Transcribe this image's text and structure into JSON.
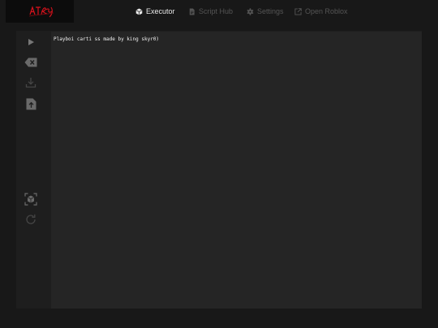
{
  "app": {
    "logo_text": "ATRRY"
  },
  "nav": {
    "items": [
      {
        "label": "Executor",
        "icon": "cube-icon",
        "active": true
      },
      {
        "label": "Script Hub",
        "icon": "document-icon",
        "active": false
      },
      {
        "label": "Settings",
        "icon": "gear-icon",
        "active": false
      },
      {
        "label": "Open Roblox",
        "icon": "external-link-icon",
        "active": false
      }
    ]
  },
  "sidebar": {
    "buttons": [
      {
        "name": "execute-button",
        "icon": "play-icon"
      },
      {
        "name": "clear-button",
        "icon": "backspace-icon"
      },
      {
        "name": "open-file-button",
        "icon": "download-icon"
      },
      {
        "name": "save-file-button",
        "icon": "upload-file-icon"
      },
      {
        "name": "inject-button",
        "icon": "cube-scan-icon"
      },
      {
        "name": "refresh-button",
        "icon": "refresh-icon"
      }
    ]
  },
  "editor": {
    "content": "Playboi carti ss made by king skyr0)"
  },
  "colors": {
    "background": "#181818",
    "panel": "#1e1e1e",
    "editor": "#252525",
    "nav_active": "#e9e9e9",
    "nav_inactive": "#555555",
    "logo_accent": "#d8121c"
  }
}
